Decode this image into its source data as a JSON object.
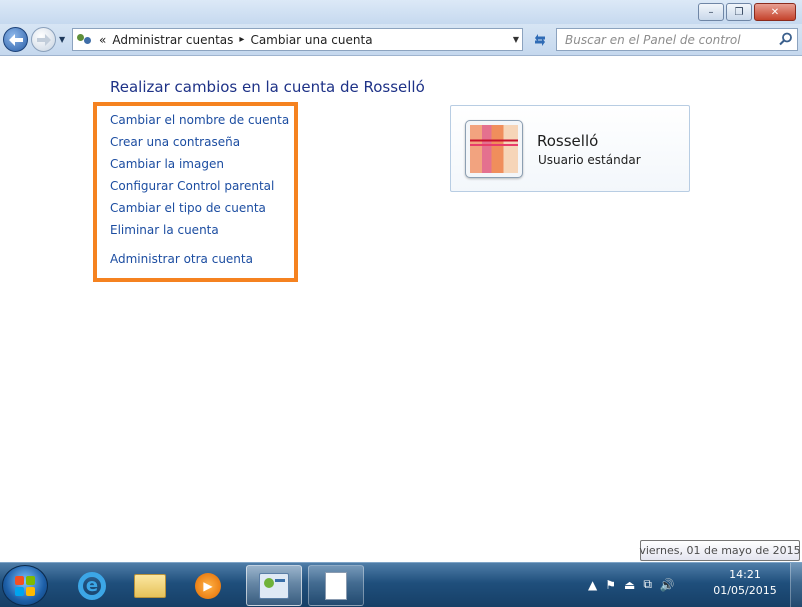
{
  "window": {
    "minimize_glyph": "–",
    "maximize_glyph": "❐",
    "close_glyph": "✕"
  },
  "address_bar": {
    "crumbs_prefix": "«",
    "breadcrumb": [
      "Administrar cuentas",
      "Cambiar una cuenta"
    ],
    "breadcrumb_separator": "▸",
    "search_placeholder": "Buscar en el Panel de control"
  },
  "page": {
    "heading": "Realizar cambios en la cuenta de Rosselló",
    "tasks": [
      "Cambiar el nombre de cuenta",
      "Crear una contraseña",
      "Cambiar la imagen",
      "Configurar Control parental",
      "Cambiar el tipo de cuenta",
      "Eliminar la cuenta"
    ],
    "other_task": "Administrar otra cuenta",
    "highlight_color": "#f58220"
  },
  "account": {
    "name": "Rosselló",
    "type": "Usuario estándar"
  },
  "tooltip": {
    "text": "viernes, 01 de mayo de 2015"
  },
  "taskbar": {
    "clock_time": "14:21",
    "clock_date": "01/05/2015",
    "tray_icons": [
      "show-hidden-icons",
      "action-center-icon",
      "safely-remove-icon",
      "network-icon",
      "volume-icon"
    ]
  },
  "colors": {
    "link": "#1c4da1",
    "heading": "#1e3287"
  }
}
